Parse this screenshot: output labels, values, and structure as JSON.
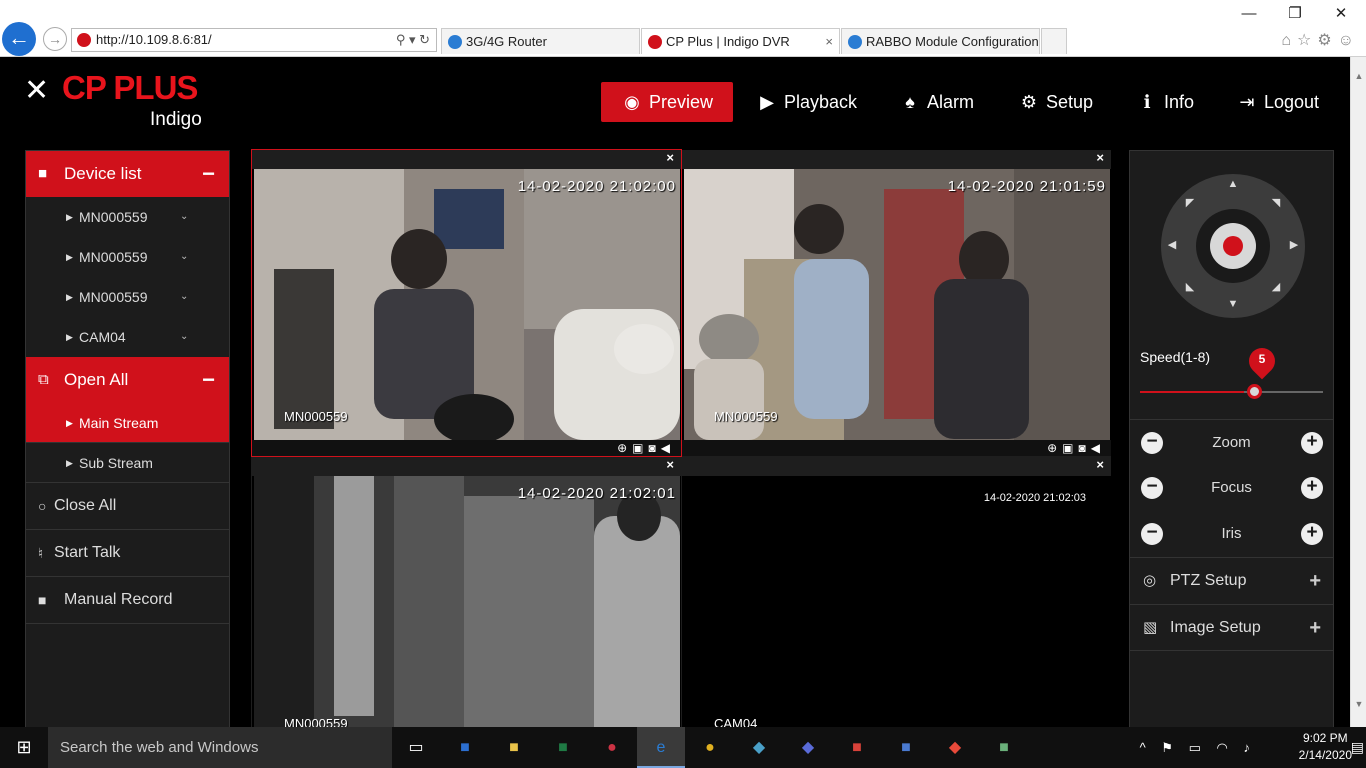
{
  "browser": {
    "url": "http://10.109.8.6:81/",
    "tabs": [
      {
        "title": "3G/4G Router"
      },
      {
        "title": "CP Plus | Indigo DVR"
      },
      {
        "title": "RABBO Module Configuration"
      }
    ],
    "tab_close": "×",
    "addr_tools": "⚲ ▾ ↻",
    "window_controls": {
      "minimize": "—",
      "restore": "❐",
      "close": "✕"
    },
    "tools": "⌂☆⚙☺"
  },
  "brand": {
    "name": "CP PLUS",
    "sub": "Indigo",
    "mark": "✕"
  },
  "nav": [
    {
      "label": "Preview",
      "icon": "eye-icon",
      "glyph": "◉"
    },
    {
      "label": "Playback",
      "icon": "play-icon",
      "glyph": "▶"
    },
    {
      "label": "Alarm",
      "icon": "bell-icon",
      "glyph": "♠"
    },
    {
      "label": "Setup",
      "icon": "gear-icon",
      "glyph": "⚙"
    },
    {
      "label": "Info",
      "icon": "info-icon",
      "glyph": "ℹ"
    },
    {
      "label": "Logout",
      "icon": "logout-icon",
      "glyph": "⇥"
    }
  ],
  "left": {
    "device_list_title": "Device list",
    "devices": [
      "MN000559",
      "MN000559",
      "MN000559",
      "CAM04"
    ],
    "open_all_title": "Open All",
    "streams": [
      "Main Stream",
      "Sub Stream"
    ],
    "close_all": "Close All",
    "start_talk": "Start Talk",
    "manual_record": "Manual Record",
    "minus": "−",
    "tri": "▶",
    "chev": "⌄"
  },
  "panes": [
    {
      "timestamp": "14-02-2020 21:02:00",
      "camera": "MN000559",
      "tools": "⊕▣◙◀"
    },
    {
      "timestamp": "14-02-2020 21:01:59",
      "camera": "MN000559",
      "tools": "⊕▣◙◀"
    },
    {
      "timestamp": "14-02-2020 21:02:01",
      "camera": "MN000559"
    },
    {
      "timestamp": "14-02-2020 21:02:03",
      "camera": "CAM04"
    }
  ],
  "pane_close": "×",
  "right": {
    "speed_label": "Speed(1-8)",
    "speed_value": "5",
    "speed_fraction": 0.57,
    "zoom": "Zoom",
    "focus": "Focus",
    "iris": "Iris",
    "ptz_setup": "PTZ Setup",
    "image_setup": "Image Setup",
    "minus": "−",
    "plus": "+"
  },
  "taskbar": {
    "search_placeholder": "Search the web and Windows",
    "time": "9:02 PM",
    "date": "2/14/2020",
    "start_glyph": "⊞",
    "tray": "^ ⚑ ▭ ◠ ♪",
    "notif": "▤"
  },
  "colors": {
    "accent": "#d0111b",
    "panel": "#1c1c1c",
    "background": "#000000"
  }
}
